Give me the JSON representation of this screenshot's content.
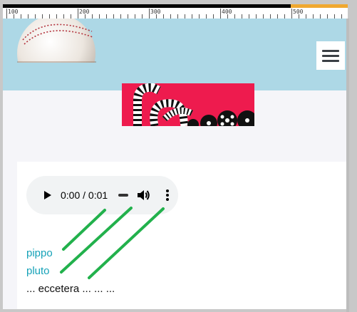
{
  "ruler": {
    "labels": [
      "100",
      "200",
      "300",
      "400",
      "500"
    ]
  },
  "header": {
    "logo_icon": "baseball-icon",
    "menu_icon": "hamburger-menu-icon",
    "background": "#add8e6"
  },
  "banner": {
    "icon": "film-reel-icon",
    "background": "#ee1b4e"
  },
  "audio": {
    "time": "0:00 / 0:01",
    "play_icon": "play-icon",
    "volume_icon": "volume-icon",
    "more_icon": "more-vertical-icon"
  },
  "links": [
    {
      "label": "pippo"
    },
    {
      "label": "pluto"
    }
  ],
  "footer_text": "... eccetera ... ... ...",
  "colors": {
    "link": "#16a2b8",
    "annotation": "#22b14c"
  }
}
